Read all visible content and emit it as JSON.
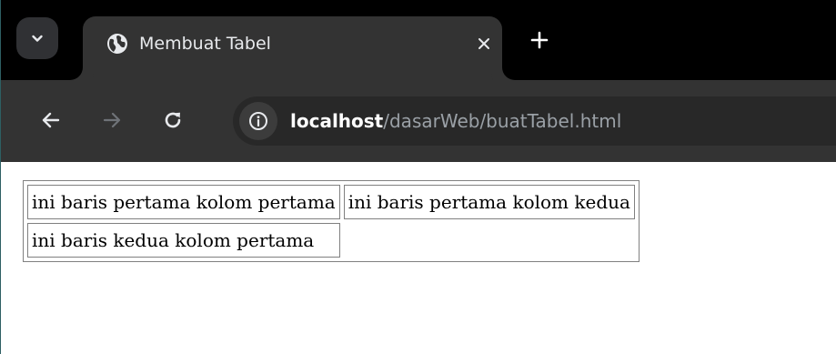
{
  "browser": {
    "tab": {
      "title": "Membuat Tabel",
      "favicon": "globe-icon"
    },
    "icons": {
      "tab_search": "chevron-down-icon",
      "tab_close": "close-icon",
      "new_tab": "plus-icon",
      "back": "arrow-left-icon",
      "forward": "arrow-right-icon",
      "reload": "reload-icon",
      "site_info": "info-icon"
    },
    "address_bar": {
      "host": "localhost",
      "path": "/dasarWeb/buatTabel.html"
    },
    "colors": {
      "tabstrip": "#000000",
      "toolbar": "#333333",
      "omnibox": "#282828",
      "url_host": "#ffffff",
      "url_path": "#9aa0a6"
    }
  },
  "page": {
    "table": {
      "rows": [
        [
          "ini baris pertama kolom pertama",
          "ini baris pertama kolom kedua"
        ],
        [
          "ini baris kedua kolom pertama"
        ]
      ]
    }
  }
}
